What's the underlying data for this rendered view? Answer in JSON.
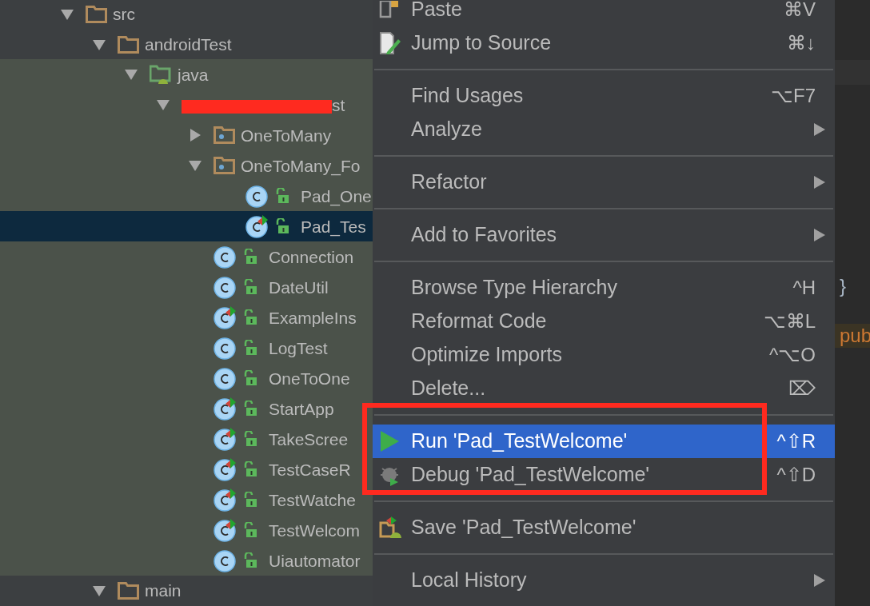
{
  "project_tree": [
    {
      "label": "src",
      "kind": "folder",
      "expanded": true,
      "children": [
        {
          "label": "androidTest",
          "kind": "folder",
          "expanded": true,
          "children": [
            {
              "label": "java",
              "kind": "source_folder",
              "expanded": true,
              "children": [
                {
                  "label": "st",
                  "kind": "redacted_package",
                  "expanded": true,
                  "children": [
                    {
                      "label": "OneToMany",
                      "kind": "package",
                      "expanded": false
                    },
                    {
                      "label": "OneToMany_Fo",
                      "kind": "package",
                      "expanded": true,
                      "children": [
                        {
                          "label": "Pad_One",
                          "kind": "class",
                          "runnable": false,
                          "selected": false
                        },
                        {
                          "label": "Pad_Tes",
                          "kind": "class",
                          "runnable": true,
                          "selected": true
                        }
                      ]
                    },
                    {
                      "label": "Connection",
                      "kind": "class",
                      "runnable": false,
                      "selected": false
                    },
                    {
                      "label": "DateUtil",
                      "kind": "class",
                      "runnable": false,
                      "selected": false
                    },
                    {
                      "label": "ExampleIns",
                      "kind": "class",
                      "runnable": true,
                      "selected": false
                    },
                    {
                      "label": "LogTest",
                      "kind": "class",
                      "runnable": false,
                      "selected": false
                    },
                    {
                      "label": "OneToOne",
                      "kind": "class",
                      "runnable": false,
                      "selected": false
                    },
                    {
                      "label": "StartApp",
                      "kind": "class",
                      "runnable": true,
                      "selected": false
                    },
                    {
                      "label": "TakeScree",
                      "kind": "class",
                      "runnable": true,
                      "selected": false
                    },
                    {
                      "label": "TestCaseR",
                      "kind": "class",
                      "runnable": true,
                      "selected": false
                    },
                    {
                      "label": "TestWatche",
                      "kind": "class",
                      "runnable": true,
                      "selected": false
                    },
                    {
                      "label": "TestWelcom",
                      "kind": "class",
                      "runnable": true,
                      "selected": false
                    },
                    {
                      "label": "Uiautomator",
                      "kind": "class",
                      "runnable": false,
                      "selected": false
                    }
                  ]
                }
              ]
            }
          ]
        },
        {
          "label": "main",
          "kind": "folder",
          "expanded": true
        }
      ]
    }
  ],
  "context_menu": [
    {
      "kind": "item",
      "label": "Paste",
      "shortcut": "⌘V",
      "selected": false
    },
    {
      "kind": "item",
      "label": "Jump to Source",
      "shortcut": "⌘↓",
      "selected": false
    },
    {
      "kind": "separator"
    },
    {
      "kind": "item",
      "label": "Find Usages",
      "shortcut": "⌥F7",
      "selected": false
    },
    {
      "kind": "submenu",
      "label": "Analyze",
      "selected": false
    },
    {
      "kind": "separator"
    },
    {
      "kind": "submenu",
      "label": "Refactor",
      "selected": false
    },
    {
      "kind": "separator"
    },
    {
      "kind": "submenu",
      "label": "Add to Favorites",
      "selected": false
    },
    {
      "kind": "separator"
    },
    {
      "kind": "item",
      "label": "Browse Type Hierarchy",
      "shortcut": "^H",
      "selected": false
    },
    {
      "kind": "item",
      "label": "Reformat Code",
      "shortcut": "⌥⌘L",
      "selected": false
    },
    {
      "kind": "item",
      "label": "Optimize Imports",
      "shortcut": "^⌥O",
      "selected": false
    },
    {
      "kind": "item",
      "label": "Delete...",
      "shortcut": "⌦",
      "selected": false
    },
    {
      "kind": "separator"
    },
    {
      "kind": "item",
      "label": "Run 'Pad_TestWelcome'",
      "shortcut": "^⇧R",
      "selected": true
    },
    {
      "kind": "item",
      "label": "Debug 'Pad_TestWelcome'",
      "shortcut": "^⇧D",
      "selected": false
    },
    {
      "kind": "separator"
    },
    {
      "kind": "item",
      "label": "Save 'Pad_TestWelcome'",
      "selected": false
    },
    {
      "kind": "separator"
    },
    {
      "kind": "submenu",
      "label": "Local History",
      "selected": false
    }
  ],
  "editor": {
    "lines": [
      {
        "text": "}",
        "kind": "plain"
      },
      {
        "text": "pub",
        "kind": "match"
      }
    ]
  }
}
